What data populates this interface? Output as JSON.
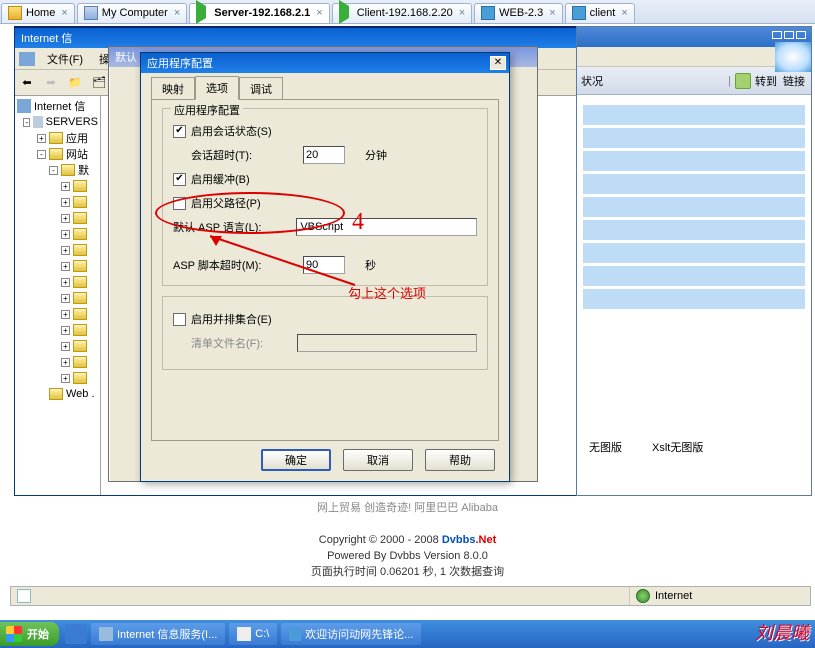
{
  "tabs": [
    {
      "label": "Home",
      "active": false
    },
    {
      "label": "My Computer",
      "active": false
    },
    {
      "label": "Server-192.168.2.1",
      "active": true
    },
    {
      "label": "Client-192.168.2.20",
      "active": false
    },
    {
      "label": "WEB-2.3",
      "active": false
    },
    {
      "label": "client",
      "active": false
    }
  ],
  "iis": {
    "title": "Internet 信",
    "menus": [
      "文件(F)",
      "操"
    ],
    "tree": {
      "root": "Internet 信",
      "server": "SERVERS",
      "nodes": [
        "应用",
        "网站",
        "默"
      ],
      "web": "Web ."
    },
    "column": "状况"
  },
  "secondary": {
    "title": "默认"
  },
  "dialog": {
    "title": "应用程序配置",
    "tabs": [
      "映射",
      "选项",
      "调试"
    ],
    "group1": {
      "legend": "应用程序配置",
      "enable_session": "启用会话状态(S)",
      "session_timeout_label": "会话超时(T):",
      "session_timeout_value": "20",
      "session_timeout_unit": "分钟",
      "enable_buffer": "启用缓冲(B)",
      "enable_parent": "启用父路径(P)",
      "asp_lang_label": "默认 ASP 语言(L):",
      "asp_lang_value": "VBScript",
      "script_timeout_label": "ASP 脚本超时(M):",
      "script_timeout_value": "90",
      "script_timeout_unit": "秒"
    },
    "group2": {
      "enable_sxs": "启用并排集合(E)",
      "manifest_label": "清单文件名(F):"
    },
    "buttons": {
      "ok": "确定",
      "cancel": "取消",
      "help": "帮助"
    }
  },
  "annotation": {
    "number": "4",
    "text": "勾上这个选项"
  },
  "rbrowser": {
    "go": "转到",
    "links": "链接",
    "col1": "无图版",
    "col2": "Xslt无图版"
  },
  "credits": {
    "line0": "网上贸易 创造奇迹! 阿里巴巴 Alibaba",
    "line1_a": "Copyright © 2000 - 2008 ",
    "line1_b": "Dvbbs",
    "line1_c": ".Net",
    "line2": "Powered By Dvbbs Version 8.0.0",
    "line3": "页面执行时间 0.06201 秒, 1 次数据查询"
  },
  "status": {
    "zone": "Internet"
  },
  "taskbar": {
    "start": "开始",
    "items": [
      "Internet 信息服务(I...",
      "C:\\",
      "欢迎访问动网先锋论..."
    ]
  },
  "brand": "刘晨曦"
}
